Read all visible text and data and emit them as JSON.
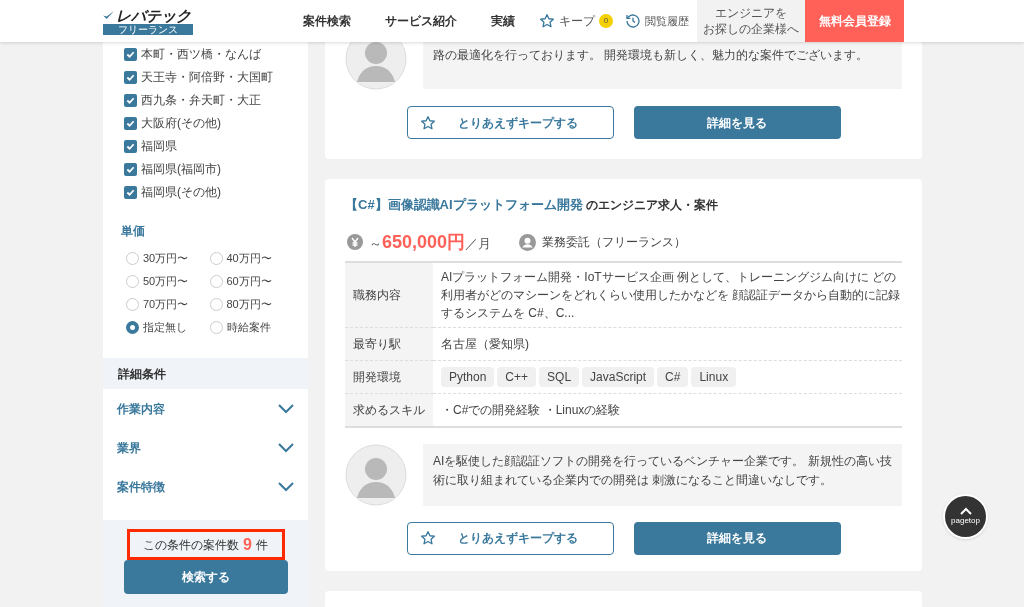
{
  "header": {
    "logo": "レバテック",
    "logo_sub": "フリーランス",
    "nav": [
      "案件検索",
      "サービス紹介",
      "実績"
    ],
    "keep": {
      "label": "キープ",
      "count": "0"
    },
    "history": "閲覧履歴",
    "corporate": [
      "エンジニアを",
      "お探しの企業様へ"
    ],
    "register": "無料会員登録"
  },
  "sidebar": {
    "areas": [
      {
        "label": "本町・西ツ橋・なんば",
        "checked": true
      },
      {
        "label": "天王寺・阿倍野・大国町",
        "checked": true
      },
      {
        "label": "西九条・弁天町・大正",
        "checked": true
      },
      {
        "label": "大阪府(その他)",
        "checked": true
      },
      {
        "label": "福岡県",
        "checked": true
      },
      {
        "label": "福岡県(福岡市)",
        "checked": true
      },
      {
        "label": "福岡県(その他)",
        "checked": true
      }
    ],
    "price": {
      "title": "単価",
      "options": [
        {
          "label": "30万円〜",
          "selected": false
        },
        {
          "label": "40万円〜",
          "selected": false
        },
        {
          "label": "50万円〜",
          "selected": false
        },
        {
          "label": "60万円〜",
          "selected": false
        },
        {
          "label": "70万円〜",
          "selected": false
        },
        {
          "label": "80万円〜",
          "selected": false
        },
        {
          "label": "指定無し",
          "selected": true
        },
        {
          "label": "時給案件",
          "selected": false
        }
      ]
    },
    "detail": {
      "title": "詳細条件",
      "sections": [
        {
          "label": "作業内容",
          "expanded": false
        },
        {
          "label": "業界",
          "expanded": false
        },
        {
          "label": "案件特徴",
          "expanded": false
        }
      ]
    },
    "result": {
      "prefix": "この条件の案件数",
      "count": "9",
      "suffix": "件"
    },
    "search_button": "検索する"
  },
  "jobs": [
    {
      "comment": "路の最適化を行っております。 開発環境も新しく、魅力的な案件でございます。",
      "keep_button": "とりあえずキープする",
      "detail_button": "詳細を見る"
    },
    {
      "title_tag": "【C#】画像認識AIプラットフォーム開発",
      "title_suffix": "のエンジニア求人・案件",
      "price_prefix": "～",
      "price": "650,000円",
      "price_unit": "／月",
      "contract": "業務委託（フリーランス）",
      "rows": [
        {
          "kind": "text",
          "label": "職務内容",
          "value": "AIプラットフォーム開発・IoTサービス企画 例として、トレーニングジム向けに どの利用者がどのマシーンをどれくらい使用したかなどを 顔認証データから自動的に記録するシステムを C#、C..."
        },
        {
          "kind": "text",
          "label": "最寄り駅",
          "value": "名古屋（愛知県)"
        },
        {
          "kind": "tags",
          "label": "開発環境",
          "tags": [
            "Python",
            "C++",
            "SQL",
            "JavaScript",
            "C#",
            "Linux"
          ]
        },
        {
          "kind": "text",
          "label": "求めるスキル",
          "value": "・C#での開発経験 ・Linuxの経験"
        }
      ],
      "comment": "AIを駆使した顔認証ソフトの開発を行っているベンチャー企業です。 新規性の高い技術に取り組まれている企業内での開発は 刺激になること間違いなしです。",
      "keep_button": "とりあえずキープする",
      "detail_button": "詳細を見る"
    }
  ],
  "pagetop": "pagetop"
}
